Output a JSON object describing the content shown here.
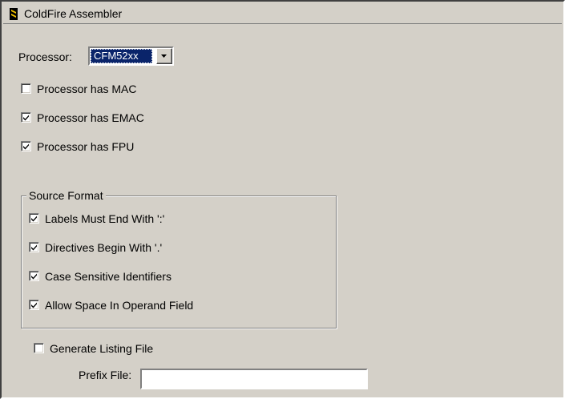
{
  "header": {
    "title": "ColdFire Assembler",
    "icon": "coldfire-icon"
  },
  "processor": {
    "label": "Processor:",
    "selected": "CFM52xx"
  },
  "options": {
    "has_mac": {
      "label": "Processor has MAC",
      "checked": false
    },
    "has_emac": {
      "label": "Processor has EMAC",
      "checked": true
    },
    "has_fpu": {
      "label": "Processor has FPU",
      "checked": true
    }
  },
  "source_format": {
    "legend": "Source Format",
    "labels_end": {
      "label": "Labels Must End With ':'",
      "checked": true
    },
    "directives_begin": {
      "label": "Directives Begin With '.'",
      "checked": true
    },
    "case_sensitive": {
      "label": "Case Sensitive Identifiers",
      "checked": true
    },
    "allow_space": {
      "label": "Allow Space In Operand Field",
      "checked": true
    }
  },
  "listing": {
    "generate": {
      "label": "Generate Listing File",
      "checked": false
    },
    "prefix_label": "Prefix File:",
    "prefix_value": ""
  },
  "colors": {
    "face": "#d4d0c8",
    "selection": "#0a246a",
    "icon_stripe": "#f5c400"
  }
}
